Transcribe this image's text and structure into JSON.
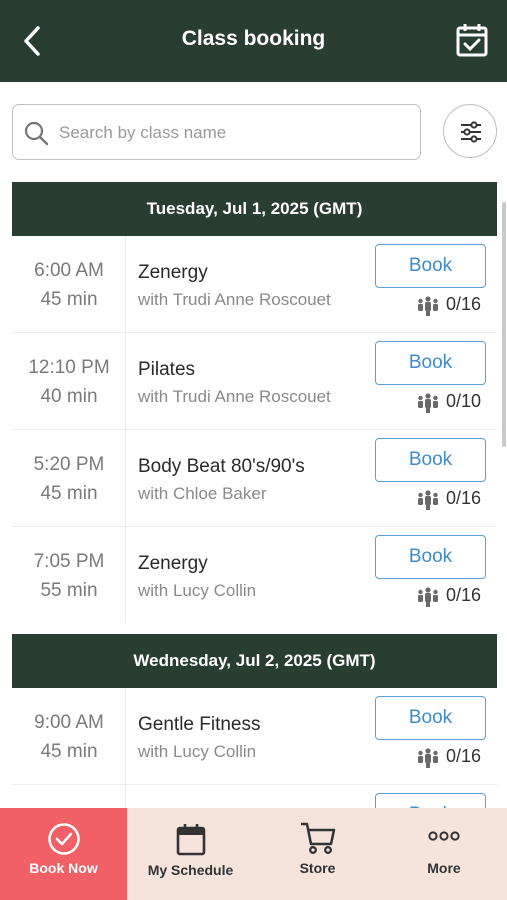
{
  "header": {
    "title": "Class booking",
    "back_icon": "chevron-left-icon",
    "calendar_icon": "calendar-check-icon"
  },
  "search": {
    "placeholder": "Search by class name"
  },
  "days": [
    {
      "label": "Tuesday, Jul 1, 2025 (GMT)",
      "classes": [
        {
          "time": "6:00  AM",
          "duration": "45 min",
          "name": "Zenergy",
          "instructor": "with Trudi Anne Roscouet",
          "book": "Book",
          "capacity": "0/16"
        },
        {
          "time": "12:10  PM",
          "duration": "40 min",
          "name": "Pilates",
          "instructor": "with Trudi Anne Roscouet",
          "book": "Book",
          "capacity": "0/10"
        },
        {
          "time": "5:20  PM",
          "duration": "45 min",
          "name": "Body Beat 80's/90's",
          "instructor": "with Chloe Baker",
          "book": "Book",
          "capacity": "0/16"
        },
        {
          "time": "7:05  PM",
          "duration": "55 min",
          "name": "Zenergy",
          "instructor": "with Lucy Collin",
          "book": "Book",
          "capacity": "0/16"
        }
      ]
    },
    {
      "label": "Wednesday, Jul 2, 2025 (GMT)",
      "classes": [
        {
          "time": "9:00  AM",
          "duration": "45 min",
          "name": "Gentle Fitness",
          "instructor": "with Lucy Collin",
          "book": "Book",
          "capacity": "0/16"
        },
        {
          "time": "",
          "duration": "",
          "name": "",
          "instructor": "",
          "book": "Book",
          "capacity": ""
        }
      ]
    }
  ],
  "nav": [
    {
      "label": "Book Now",
      "icon": "check-circle-icon",
      "active": true
    },
    {
      "label": "My Schedule",
      "icon": "calendar-icon",
      "active": false
    },
    {
      "label": "Store",
      "icon": "cart-icon",
      "active": false
    },
    {
      "label": "More",
      "icon": "more-dots-icon",
      "active": false
    }
  ],
  "colors": {
    "header_bg": "#2a3d31",
    "accent_blue": "#3d8ccc",
    "nav_bg": "#f5e4dc",
    "nav_active": "#f06066"
  }
}
